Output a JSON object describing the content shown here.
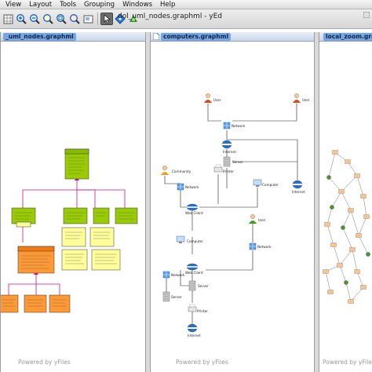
{
  "menubar": {
    "items": [
      "View",
      "Layout",
      "Tools",
      "Grouping",
      "Windows",
      "Help"
    ]
  },
  "window": {
    "title": "dol_uml_nodes.graphml - yEd"
  },
  "panes": [
    {
      "tab": "_uml_nodes.graphml",
      "footer": "Powered by yFiles"
    },
    {
      "tab": "computers.graphml",
      "footer": "Powered by yFiles"
    },
    {
      "tab": "local_zoom.graphm",
      "footer": "Powered by yFiles"
    }
  ],
  "computers_graph": {
    "user_label": "User",
    "network_label": "Network",
    "internet_label": "Internet",
    "server_label": "Server",
    "printer_label": "Printer",
    "computer_label": "Computer",
    "community_label": "Community",
    "webclient_label": "Web Client"
  },
  "colors": {
    "uml_green": "#99cc00",
    "uml_yellow": "#ffff99",
    "uml_orange": "#ff9933",
    "uml_edge": "#c71585",
    "tab_blue": "#7aa6df",
    "local_node": "#f5c59a"
  }
}
